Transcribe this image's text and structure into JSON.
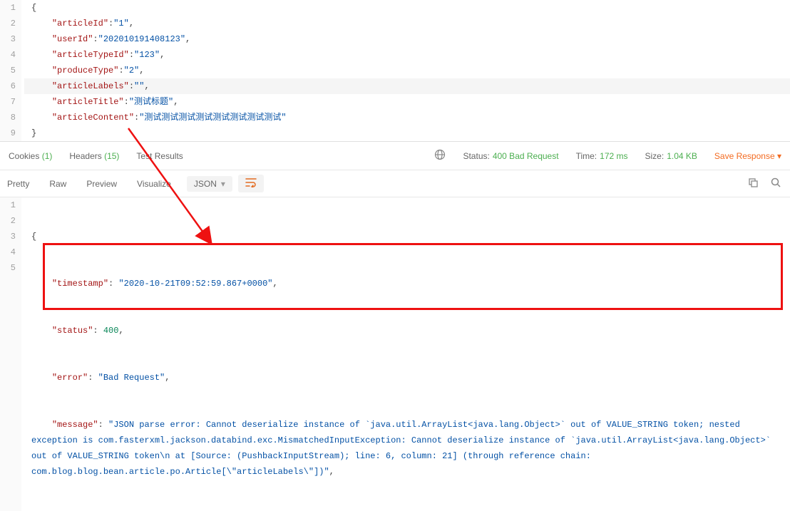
{
  "request": {
    "lines": [
      {
        "n": 1,
        "indent": 0,
        "type": "brace",
        "content": "{"
      },
      {
        "n": 2,
        "indent": 1,
        "key": "\"articleId\"",
        "val": "\"1\"",
        "comma": true
      },
      {
        "n": 3,
        "indent": 1,
        "key": "\"userId\"",
        "val": "\"202010191408123\"",
        "comma": true
      },
      {
        "n": 4,
        "indent": 1,
        "key": "\"articleTypeId\"",
        "val": "\"123\"",
        "comma": true
      },
      {
        "n": 5,
        "indent": 1,
        "key": "\"produceType\"",
        "val": "\"2\"",
        "comma": true
      },
      {
        "n": 6,
        "indent": 1,
        "key": "\"articleLabels\"",
        "val": "\"\"",
        "comma": true,
        "active": true
      },
      {
        "n": 7,
        "indent": 1,
        "key": "\"articleTitle\"",
        "val": "\"测试标题\"",
        "comma": true
      },
      {
        "n": 8,
        "indent": 1,
        "key": "\"articleContent\"",
        "val": "\"测试测试测试测试测试测试测试测试\"",
        "comma": false
      },
      {
        "n": 9,
        "indent": 0,
        "type": "brace",
        "content": "}"
      }
    ]
  },
  "tabs": {
    "cookies": {
      "label": "Cookies",
      "count": "(1)"
    },
    "headers": {
      "label": "Headers",
      "count": "(15)"
    },
    "test": {
      "label": "Test Results"
    },
    "status_label": "Status:",
    "status_val": "400 Bad Request",
    "time_label": "Time:",
    "time_val": "172 ms",
    "size_label": "Size:",
    "size_val": "1.04 KB",
    "save": "Save Response"
  },
  "viewbar": {
    "pretty": "Pretty",
    "raw": "Raw",
    "preview": "Preview",
    "visualize": "Visualize",
    "format": "JSON"
  },
  "response": {
    "l1": "{",
    "l2k": "\"timestamp\"",
    "l2v": "\"2020-10-21T09:52:59.867+0000\"",
    "l3k": "\"status\"",
    "l3v": "400",
    "l4k": "\"error\"",
    "l4v": "\"Bad Request\"",
    "l5k": "\"message\"",
    "l5v": "\"JSON parse error: Cannot deserialize instance of `java.util.ArrayList<java.lang.Object>` out of VALUE_STRING token; nested exception is com.fasterxml.jackson.databind.exc.MismatchedInputException: Cannot deserialize instance of `java.util.ArrayList<java.lang.Object>` out of VALUE_STRING token\\n at [Source: (PushbackInputStream); line: 6, column: 21] (through reference chain: com.blog.blog.bean.article.po.Article[\\\"articleLabels\\\"])\""
  }
}
